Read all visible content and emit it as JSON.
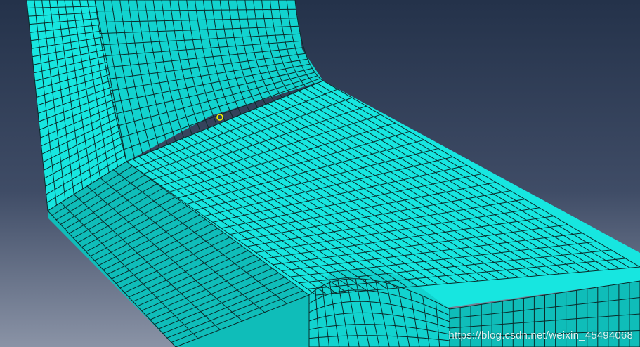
{
  "viewport": {
    "background_top": "#24324a",
    "background_bottom": "#8a93a6"
  },
  "mesh": {
    "face_color_light": "#17e6e0",
    "face_color_mid": "#12d3cf",
    "face_color_dark": "#0fbdb9",
    "edge_color": "#0a2a2a"
  },
  "cursor": {
    "icon": "pick-circle-icon",
    "color": "#f4f400"
  },
  "watermark": {
    "text": "https://blog.csdn.net/weixin_45494068"
  }
}
